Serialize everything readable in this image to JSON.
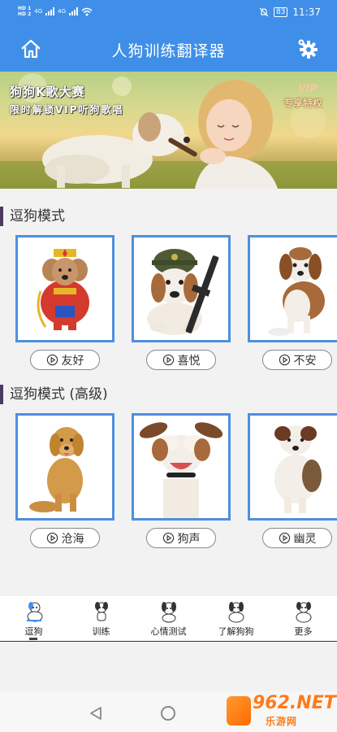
{
  "status_bar": {
    "hd1": "HD 1",
    "hd2": "HD 2",
    "net1": "4G",
    "net2": "4G",
    "battery": "83",
    "time": "11:37"
  },
  "app_bar": {
    "title": "人狗训练翻译器"
  },
  "banner": {
    "line1": "狗狗K歌大赛",
    "line2": "限时解锁VIP听狗歌唱",
    "vip": "VIP",
    "vip_sub": "专享特权"
  },
  "section1": {
    "title": "逗狗模式",
    "items": [
      {
        "label": "友好",
        "icon": "costumed-poodle"
      },
      {
        "label": "喜悦",
        "icon": "soldier-beagle"
      },
      {
        "label": "不安",
        "icon": "beagle-puppy"
      }
    ]
  },
  "section2": {
    "title": "逗狗模式 (高级)",
    "items": [
      {
        "label": "沧海",
        "icon": "golden-retriever"
      },
      {
        "label": "狗声",
        "icon": "jack-russell-covering-eyes"
      },
      {
        "label": "幽灵",
        "icon": "shepherd-puppy"
      }
    ]
  },
  "bottom_nav": {
    "items": [
      {
        "label": "逗狗",
        "icon": "dog-play-icon",
        "active": true
      },
      {
        "label": "训练",
        "icon": "dog-train-icon"
      },
      {
        "label": "心情测试",
        "icon": "dog-mood-icon"
      },
      {
        "label": "了解狗狗",
        "icon": "dog-info-icon"
      },
      {
        "label": "更多",
        "icon": "dog-more-icon"
      }
    ]
  },
  "watermark": {
    "number": "962.NET",
    "sub": "乐游网"
  },
  "colors": {
    "primary": "#3f8fe8",
    "card_border": "#4d8fe0",
    "section_bar": "#4b3b63"
  }
}
